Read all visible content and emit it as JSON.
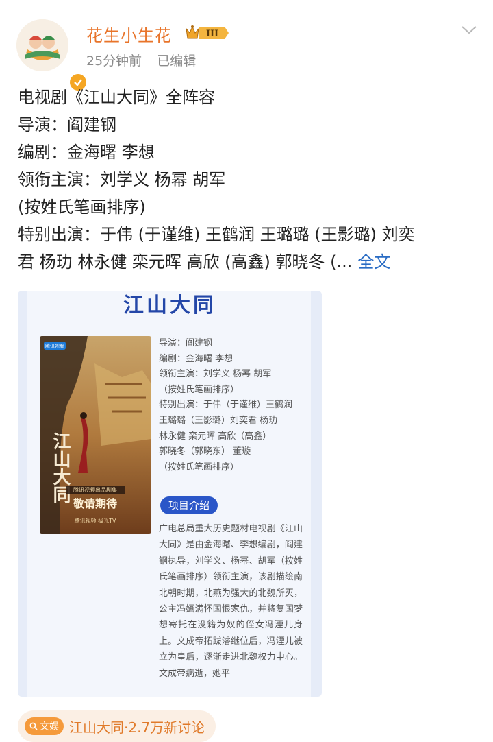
{
  "post": {
    "username": "花生小生花",
    "level": "III",
    "time": "25分钟前",
    "edited": "已编辑",
    "lines": [
      "电视剧《江山大同》全阵容",
      "导演：阎建钢",
      "编剧：金海曙 李想",
      "领衔主演：刘学义 杨幂 胡军",
      "(按姓氏笔画排序)",
      "特别出演：于伟 (于谨维) 王鹤润 王璐璐 (王影璐) 刘奕",
      "君 杨玏 林永健 栾元晖 高欣 (高鑫) 郭晓冬 (..."
    ],
    "more_label": "全文"
  },
  "card": {
    "title": "江山大同",
    "poster": {
      "platform_tag": "腾讯视频",
      "title_art": "江山大同",
      "producer_line": "腾讯视频出品剧集",
      "slogan": "敬请期待",
      "bottom_text": "腾讯视频 极光TV"
    },
    "credits": [
      "导演：阎建钢",
      "编剧：金海曙 李想",
      "领衔主演：刘学义 杨幂 胡军",
      "（按姓氏笔画排序）",
      "特别出演：于伟（于谨维）王鹤润",
      "王璐璐（王影璐）刘奕君 杨玏",
      "林永健 栾元晖 高欣（高鑫）",
      "郭晓冬（郭晓东） 董璇",
      "（按姓氏笔画排序）"
    ],
    "section_label": "项目介绍",
    "intro": "广电总局重大历史题材电视剧《江山大同》是由金海曙、李想编剧，阎建钢执导，刘学义、杨幂、胡军（按姓氏笔画排序）领衔主演，该剧描绘南北朝时期，北燕为强大的北魏所灭，公主冯婳满怀国恨家仇，并将复国梦想寄托在没籍为奴的侄女冯湮儿身上。文成帝拓跋濬继位后，冯湮儿被立为皇后，逐渐走进北魏权力中心。文成帝病逝，她平"
  },
  "topic": {
    "icon_label": "文娱",
    "text": "江山大同·2.7万新讨论"
  },
  "colors": {
    "username": "#e8742a",
    "link": "#2a6cc4",
    "card_title": "#2447a8",
    "chip": "#2a56c8"
  }
}
